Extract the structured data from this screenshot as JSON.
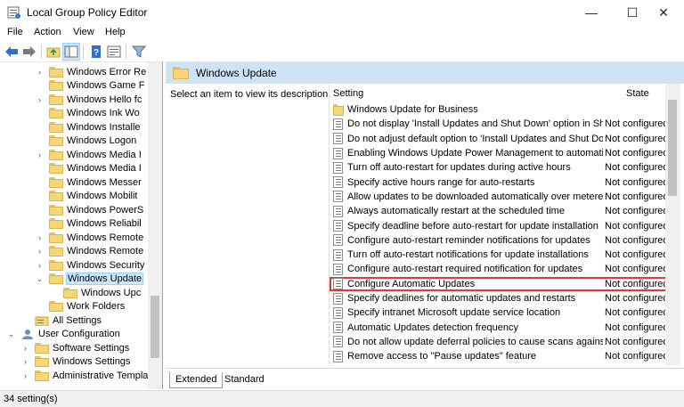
{
  "window": {
    "title": "Local Group Policy Editor",
    "controls": {
      "minimize": "—",
      "maximize": "☐",
      "close": "✕"
    }
  },
  "menu": [
    "File",
    "Action",
    "View",
    "Help"
  ],
  "toolbar": {
    "icons": [
      "back-icon",
      "forward-icon",
      "up-folder-icon",
      "show-hide-tree-icon",
      "help-icon",
      "properties-icon",
      "filter-icon"
    ]
  },
  "tree": {
    "items": [
      {
        "label": "Windows Error Re",
        "indent": 2,
        "expander": "›",
        "selected": false
      },
      {
        "label": "Windows Game F",
        "indent": 2,
        "expander": "",
        "selected": false
      },
      {
        "label": "Windows Hello fc",
        "indent": 2,
        "expander": "›",
        "selected": false
      },
      {
        "label": "Windows Ink Wo",
        "indent": 2,
        "expander": "",
        "selected": false
      },
      {
        "label": "Windows Installe",
        "indent": 2,
        "expander": "",
        "selected": false
      },
      {
        "label": "Windows Logon",
        "indent": 2,
        "expander": "",
        "selected": false
      },
      {
        "label": "Windows Media I",
        "indent": 2,
        "expander": "›",
        "selected": false
      },
      {
        "label": "Windows Media I",
        "indent": 2,
        "expander": "",
        "selected": false
      },
      {
        "label": "Windows Messer",
        "indent": 2,
        "expander": "",
        "selected": false
      },
      {
        "label": "Windows Mobilit",
        "indent": 2,
        "expander": "",
        "selected": false
      },
      {
        "label": "Windows PowerS",
        "indent": 2,
        "expander": "",
        "selected": false
      },
      {
        "label": "Windows Reliabil",
        "indent": 2,
        "expander": "",
        "selected": false
      },
      {
        "label": "Windows Remote",
        "indent": 2,
        "expander": "›",
        "selected": false
      },
      {
        "label": "Windows Remote",
        "indent": 2,
        "expander": "›",
        "selected": false
      },
      {
        "label": "Windows Security",
        "indent": 2,
        "expander": "›",
        "selected": false
      },
      {
        "label": "Windows Update",
        "indent": 2,
        "expander": "⌄",
        "selected": true
      },
      {
        "label": "Windows Upc",
        "indent": 3,
        "expander": "",
        "selected": false
      },
      {
        "label": "Work Folders",
        "indent": 2,
        "expander": "",
        "selected": false
      },
      {
        "label": "All Settings",
        "indent": 1,
        "expander": "",
        "selected": false
      },
      {
        "label": "User Configuration",
        "indent": 0,
        "expander": "⌄",
        "selected": false
      },
      {
        "label": "Software Settings",
        "indent": 1,
        "expander": "›",
        "selected": false
      },
      {
        "label": "Windows Settings",
        "indent": 1,
        "expander": "›",
        "selected": false
      },
      {
        "label": "Administrative Templa",
        "indent": 1,
        "expander": "›",
        "selected": false
      }
    ]
  },
  "details": {
    "header_title": "Windows Update",
    "description": "Select an item to view its description.",
    "columns": {
      "setting": "Setting",
      "state": "State"
    },
    "rows": [
      {
        "name": "Windows Update for Business",
        "state": "",
        "type": "folder",
        "highlight": false
      },
      {
        "name": "Do not display 'Install Updates and Shut Down' option in Sh...",
        "state": "Not configured",
        "type": "setting",
        "highlight": false
      },
      {
        "name": "Do not adjust default option to 'Install Updates and Shut Do...",
        "state": "Not configured",
        "type": "setting",
        "highlight": false
      },
      {
        "name": "Enabling Windows Update Power Management to automati...",
        "state": "Not configured",
        "type": "setting",
        "highlight": false
      },
      {
        "name": "Turn off auto-restart for updates during active hours",
        "state": "Not configured",
        "type": "setting",
        "highlight": false
      },
      {
        "name": "Specify active hours range for auto-restarts",
        "state": "Not configured",
        "type": "setting",
        "highlight": false
      },
      {
        "name": "Allow updates to be downloaded automatically over metere...",
        "state": "Not configured",
        "type": "setting",
        "highlight": false
      },
      {
        "name": "Always automatically restart at the scheduled time",
        "state": "Not configured",
        "type": "setting",
        "highlight": false
      },
      {
        "name": "Specify deadline before auto-restart for update installation",
        "state": "Not configured",
        "type": "setting",
        "highlight": false
      },
      {
        "name": "Configure auto-restart reminder notifications for updates",
        "state": "Not configured",
        "type": "setting",
        "highlight": false
      },
      {
        "name": "Turn off auto-restart notifications for update installations",
        "state": "Not configured",
        "type": "setting",
        "highlight": false
      },
      {
        "name": "Configure auto-restart required notification for updates",
        "state": "Not configured",
        "type": "setting",
        "highlight": false
      },
      {
        "name": "Configure Automatic Updates",
        "state": "Not configured",
        "type": "setting",
        "highlight": true
      },
      {
        "name": "Specify deadlines for automatic updates and restarts",
        "state": "Not configured",
        "type": "setting",
        "highlight": false
      },
      {
        "name": "Specify intranet Microsoft update service location",
        "state": "Not configured",
        "type": "setting",
        "highlight": false
      },
      {
        "name": "Automatic Updates detection frequency",
        "state": "Not configured",
        "type": "setting",
        "highlight": false
      },
      {
        "name": "Do not allow update deferral policies to cause scans against ...",
        "state": "Not configured",
        "type": "setting",
        "highlight": false
      },
      {
        "name": "Remove access to \"Pause updates\" feature",
        "state": "Not configured",
        "type": "setting",
        "highlight": false
      }
    ],
    "tabs": [
      {
        "label": "Extended",
        "active": true
      },
      {
        "label": "Standard",
        "active": false
      }
    ]
  },
  "status": {
    "text": "34 setting(s)"
  },
  "colors": {
    "header_band": "#cfe3f7",
    "selection": "#cce8ff",
    "highlight_border": "#e53935",
    "folder": "#f5d67a"
  }
}
